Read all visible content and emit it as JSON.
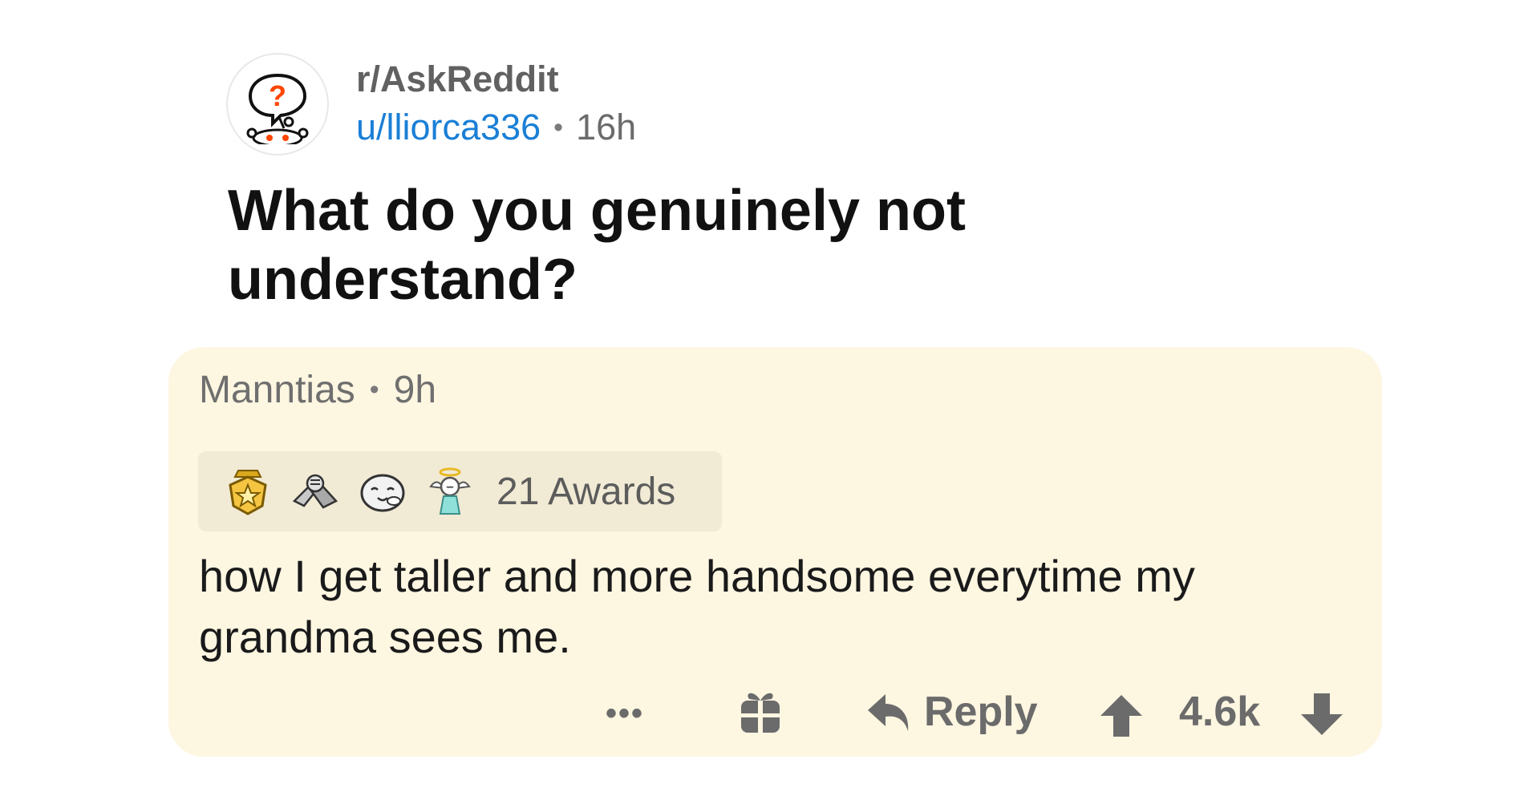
{
  "post": {
    "subreddit": "r/AskReddit",
    "username": "u/lliorca336",
    "separator": "•",
    "age": "16h",
    "title": "What do you genuinely not understand?"
  },
  "comment": {
    "author": "Manntias",
    "separator": "•",
    "age": "9h",
    "awards_label": "21 Awards",
    "award_icons": [
      "gold-medal-icon",
      "handshake-icon",
      "wholesome-seal-icon",
      "angel-icon"
    ],
    "body": "how I get taller and more handsome everytime my grandma sees me.",
    "actions": {
      "more": "•••",
      "reply": "Reply",
      "score": "4.6k"
    }
  },
  "colors": {
    "card_bg": "#fdf6e1",
    "username": "#1a7fd6",
    "muted": "#6b6b6b",
    "snoo_orange": "#ff4500"
  }
}
